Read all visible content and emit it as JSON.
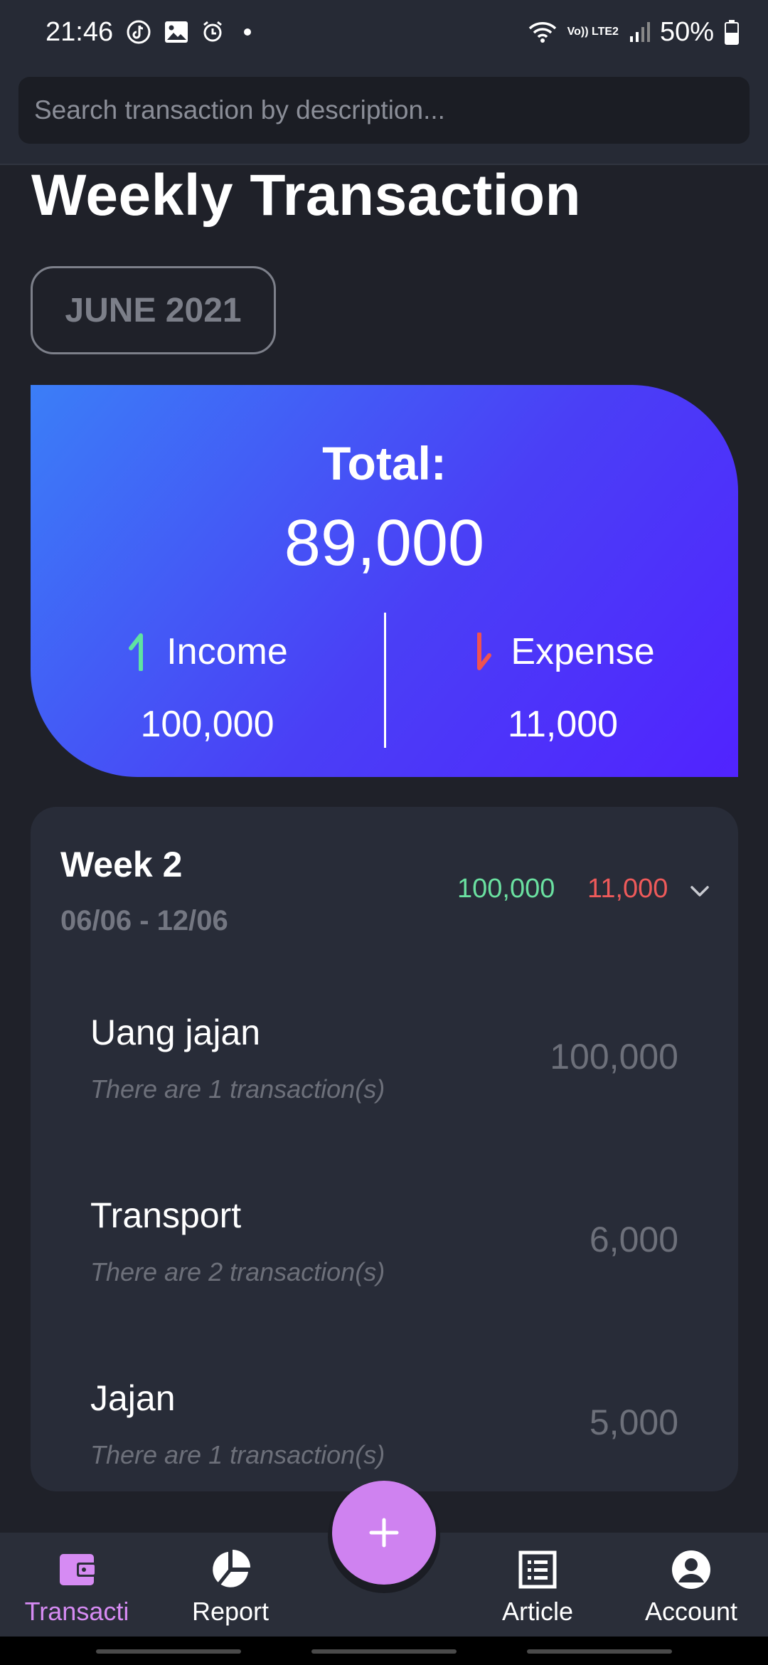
{
  "status_bar": {
    "time": "21:46",
    "battery": "50%",
    "network": "Vo)) LTE2"
  },
  "search": {
    "placeholder": "Search transaction by description..."
  },
  "page": {
    "title": "Weekly Transaction",
    "month": "JUNE 2021"
  },
  "summary": {
    "total_label": "Total:",
    "total_value": "89,000",
    "income_label": "Income",
    "income_value": "100,000",
    "expense_label": "Expense",
    "expense_value": "11,000"
  },
  "week": {
    "title": "Week 2",
    "range": "06/06 - 12/06",
    "income": "100,000",
    "expense": "11,000",
    "items": [
      {
        "name": "Uang jajan",
        "count": "There are 1 transaction(s)",
        "amount": "100,000"
      },
      {
        "name": "Transport",
        "count": "There are 2 transaction(s)",
        "amount": "6,000"
      },
      {
        "name": "Jajan",
        "count": "There are 1 transaction(s)",
        "amount": "5,000"
      }
    ]
  },
  "nav": {
    "transaction": "Transacti",
    "report": "Report",
    "article": "Article",
    "account": "Account"
  },
  "colors": {
    "income": "#6ae0a0",
    "expense": "#ee5a5a",
    "accent": "#cf82f0",
    "active_nav": "#d68bf3"
  }
}
